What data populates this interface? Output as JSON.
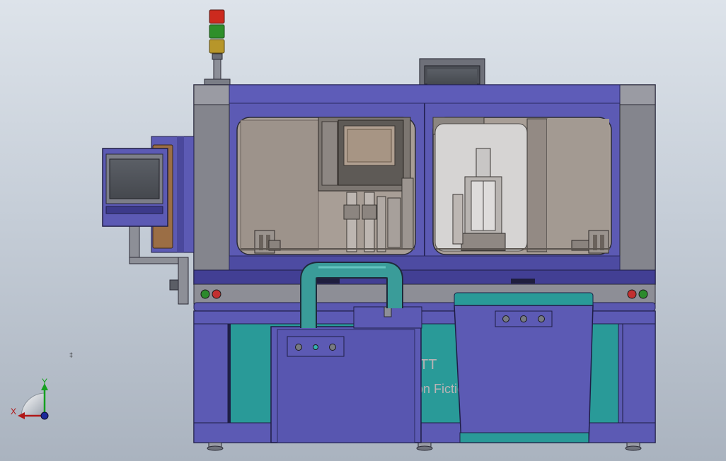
{
  "view": {
    "type": "CAD assembly front view",
    "panel_text_partial_1": "TT",
    "panel_text_partial_2": "on Fictio",
    "triad": {
      "x_label": "X",
      "y_label": "Y"
    }
  },
  "colors": {
    "background_top": "#dde3ea",
    "background_bottom": "#aab3bf",
    "frame_blue": "#5c5ab4",
    "frame_dark": "#3f3d8c",
    "side_grey": "#84858d",
    "teal": "#299a98",
    "pipe_teal": "#3a9c99",
    "window_interior": "#a89e96",
    "beacon_red": "#cc2a1e",
    "beacon_green": "#2e8f2a",
    "beacon_amber": "#b7962a",
    "triad_x": "#b01818",
    "triad_y": "#15a020"
  },
  "components": [
    "signal-tower",
    "top-monitor",
    "side-hmi-monitor",
    "left-window",
    "right-window",
    "teal-pipe",
    "left-cabinet",
    "right-cabinet",
    "indicator-lights"
  ]
}
